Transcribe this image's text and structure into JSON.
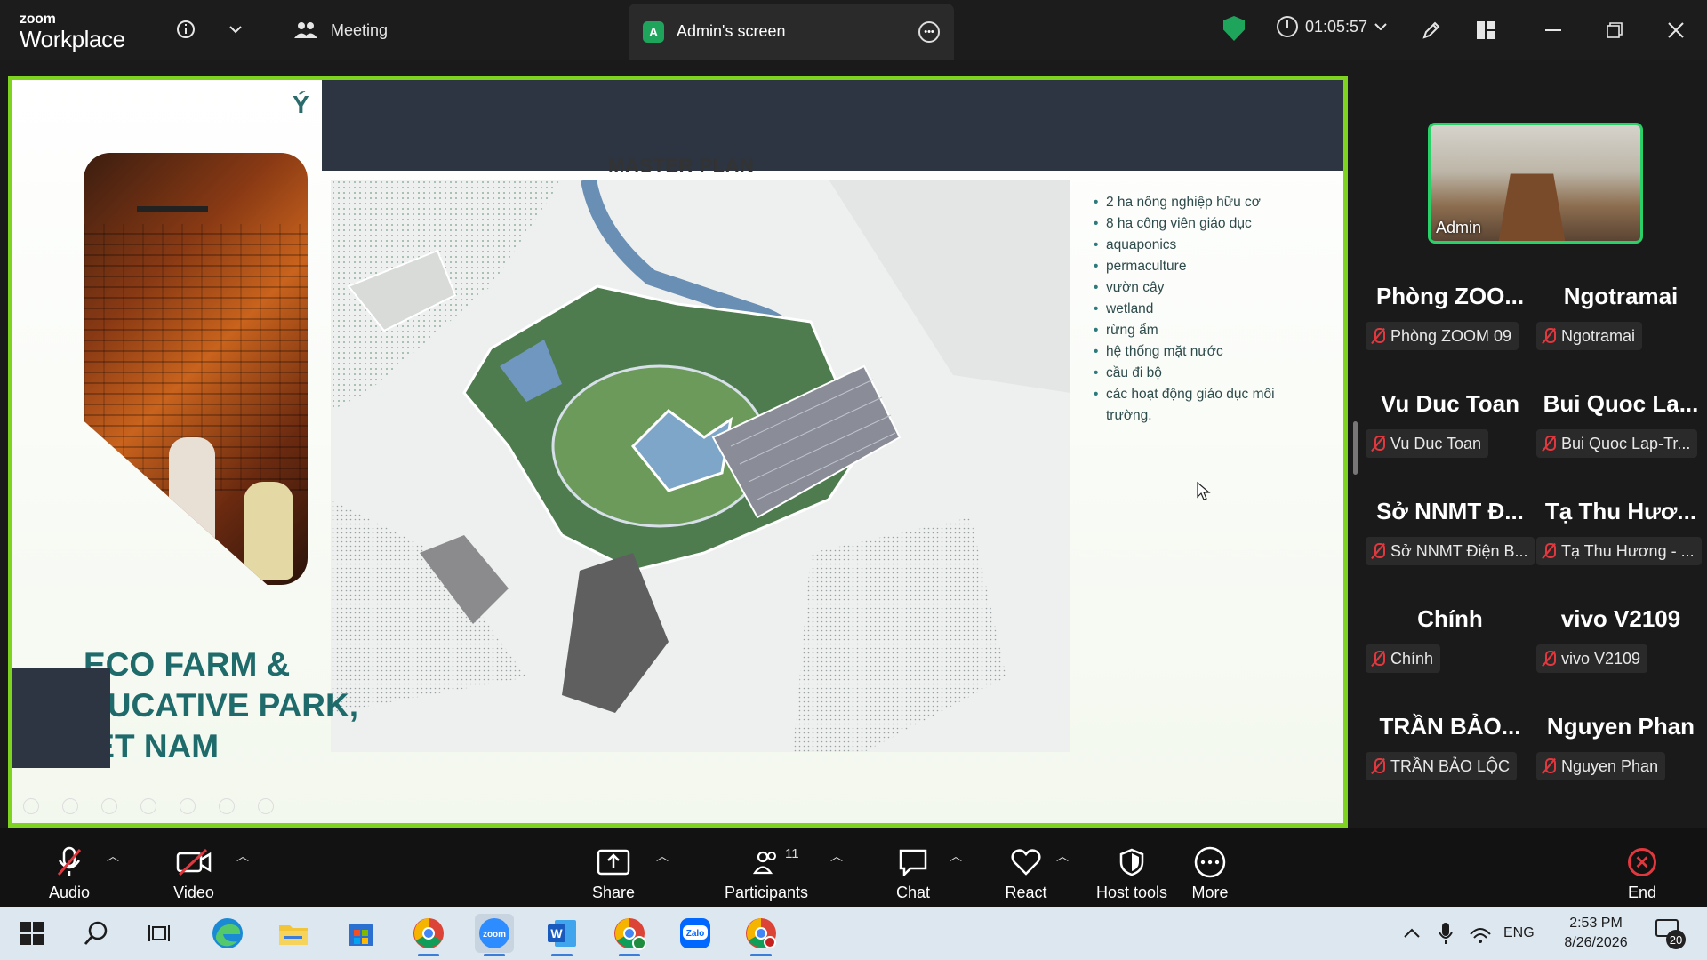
{
  "app": {
    "brand_top": "zoom",
    "brand_bottom": "Workplace",
    "meeting_tab": "Meeting",
    "screen_tab": "Admin's screen",
    "screen_tab_avatar": "A",
    "timer": "01:05:57",
    "accent_green": "#2ad168",
    "end_red": "#e0383e"
  },
  "slide": {
    "partial_title": "Ý",
    "master_plan_title": "MASTER PLAN",
    "eco_lines": [
      "ECO FARM &",
      "DUCATIVE PARK,",
      "IỆT NAM"
    ],
    "bullets": [
      "2 ha nông nghiệp hữu cơ",
      "8 ha công viên giáo dục",
      "aquaponics",
      "permaculture",
      "vườn cây",
      "wetland",
      "rừng ẩm",
      "hệ thống mặt nước",
      "cầu đi bộ",
      "các hoạt động giáo dục môi trường."
    ]
  },
  "self_video": {
    "name": "Admin"
  },
  "participants": [
    {
      "title": "Phòng ZOO...",
      "label": "Phòng ZOOM 09"
    },
    {
      "title": "Ngotramai",
      "label": "Ngotramai"
    },
    {
      "title": "Vu Duc Toan",
      "label": "Vu Duc Toan"
    },
    {
      "title": "Bui Quoc La...",
      "label": "Bui Quoc Lap-Tr..."
    },
    {
      "title": "Sở NNMT Đ...",
      "label": "Sở NNMT Điện B..."
    },
    {
      "title": "Tạ Thu Hươ...",
      "label": "Tạ Thu Hương - ..."
    },
    {
      "title": "Chính",
      "label": "Chính"
    },
    {
      "title": "vivo V2109",
      "label": "vivo V2109"
    },
    {
      "title": "TRẦN BẢO...",
      "label": "TRẦN BẢO LỘC"
    },
    {
      "title": "Nguyen Phan",
      "label": "Nguyen Phan"
    }
  ],
  "toolbar": {
    "audio": "Audio",
    "video": "Video",
    "share": "Share",
    "participants": "Participants",
    "participants_count": "11",
    "chat": "Chat",
    "react": "React",
    "host_tools": "Host tools",
    "more": "More",
    "end": "End"
  },
  "taskbar": {
    "language": "ENG",
    "time": "2:53 PM",
    "date": "8/26/2026",
    "notifications": "20",
    "zalo": "Zalo",
    "zoom": "zoom",
    "word": "W"
  }
}
